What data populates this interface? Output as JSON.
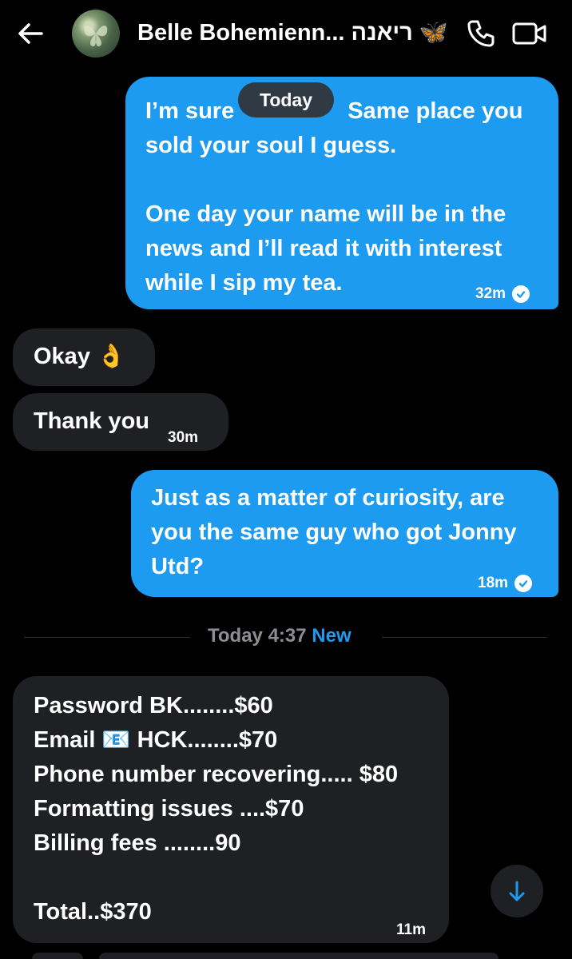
{
  "header": {
    "contact_name": "Belle Bohemienn... ריאנה 🦋"
  },
  "date_chip": "Today",
  "messages": [
    {
      "direction": "outgoing",
      "lines": [
        "I’m sure",
        "Same place you",
        "sold your soul I guess.",
        "",
        "One day your name will be in the",
        "news and I’ll read it with interest",
        "while I sip my tea."
      ],
      "time": "32m",
      "status": "sent"
    },
    {
      "direction": "incoming",
      "text": "Okay 👌"
    },
    {
      "direction": "incoming",
      "text": "Thank you",
      "time": "30m"
    },
    {
      "direction": "outgoing",
      "lines": [
        "Just as a matter of curiosity, are",
        "you the same guy who got Jonny",
        "Utd?"
      ],
      "time": "18m",
      "status": "sent"
    },
    {
      "direction": "incoming",
      "lines": [
        "Password BK........$60",
        "Email 📧 HCK........$70",
        "Phone number recovering..... $80",
        "Formatting issues ....$70",
        "Billing fees ........90",
        "",
        "Total..$370"
      ],
      "time": "11m"
    }
  ],
  "new_divider": {
    "time_label": "Today 4:37",
    "new_label": "New"
  },
  "colors": {
    "accent": "#1d9bf0",
    "background": "#000000",
    "incoming_bubble": "#1f2024"
  },
  "icons": [
    "back-arrow-icon",
    "phone-icon",
    "video-camera-icon",
    "arrow-down-icon",
    "check-circle-icon"
  ]
}
